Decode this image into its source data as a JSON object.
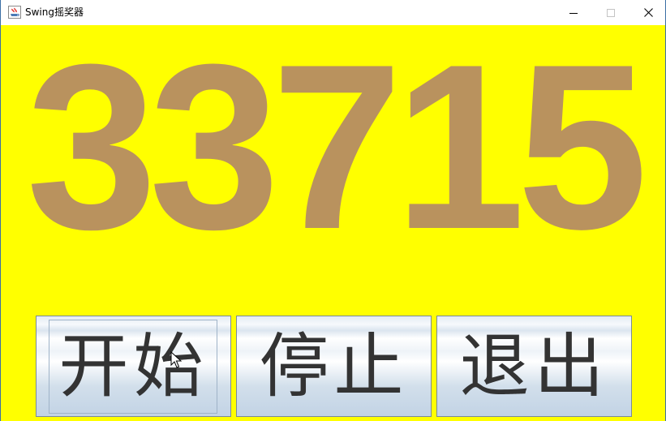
{
  "window": {
    "title": "Swing摇奖器",
    "icon": "java-cup-icon",
    "controls": [
      "minimize-icon",
      "maximize-icon",
      "close-icon"
    ]
  },
  "display": {
    "number": "33715",
    "background_color": "#ffff00",
    "text_color": "#b9925e"
  },
  "buttons": {
    "start_label": "开始",
    "stop_label": "停止",
    "exit_label": "退出"
  }
}
